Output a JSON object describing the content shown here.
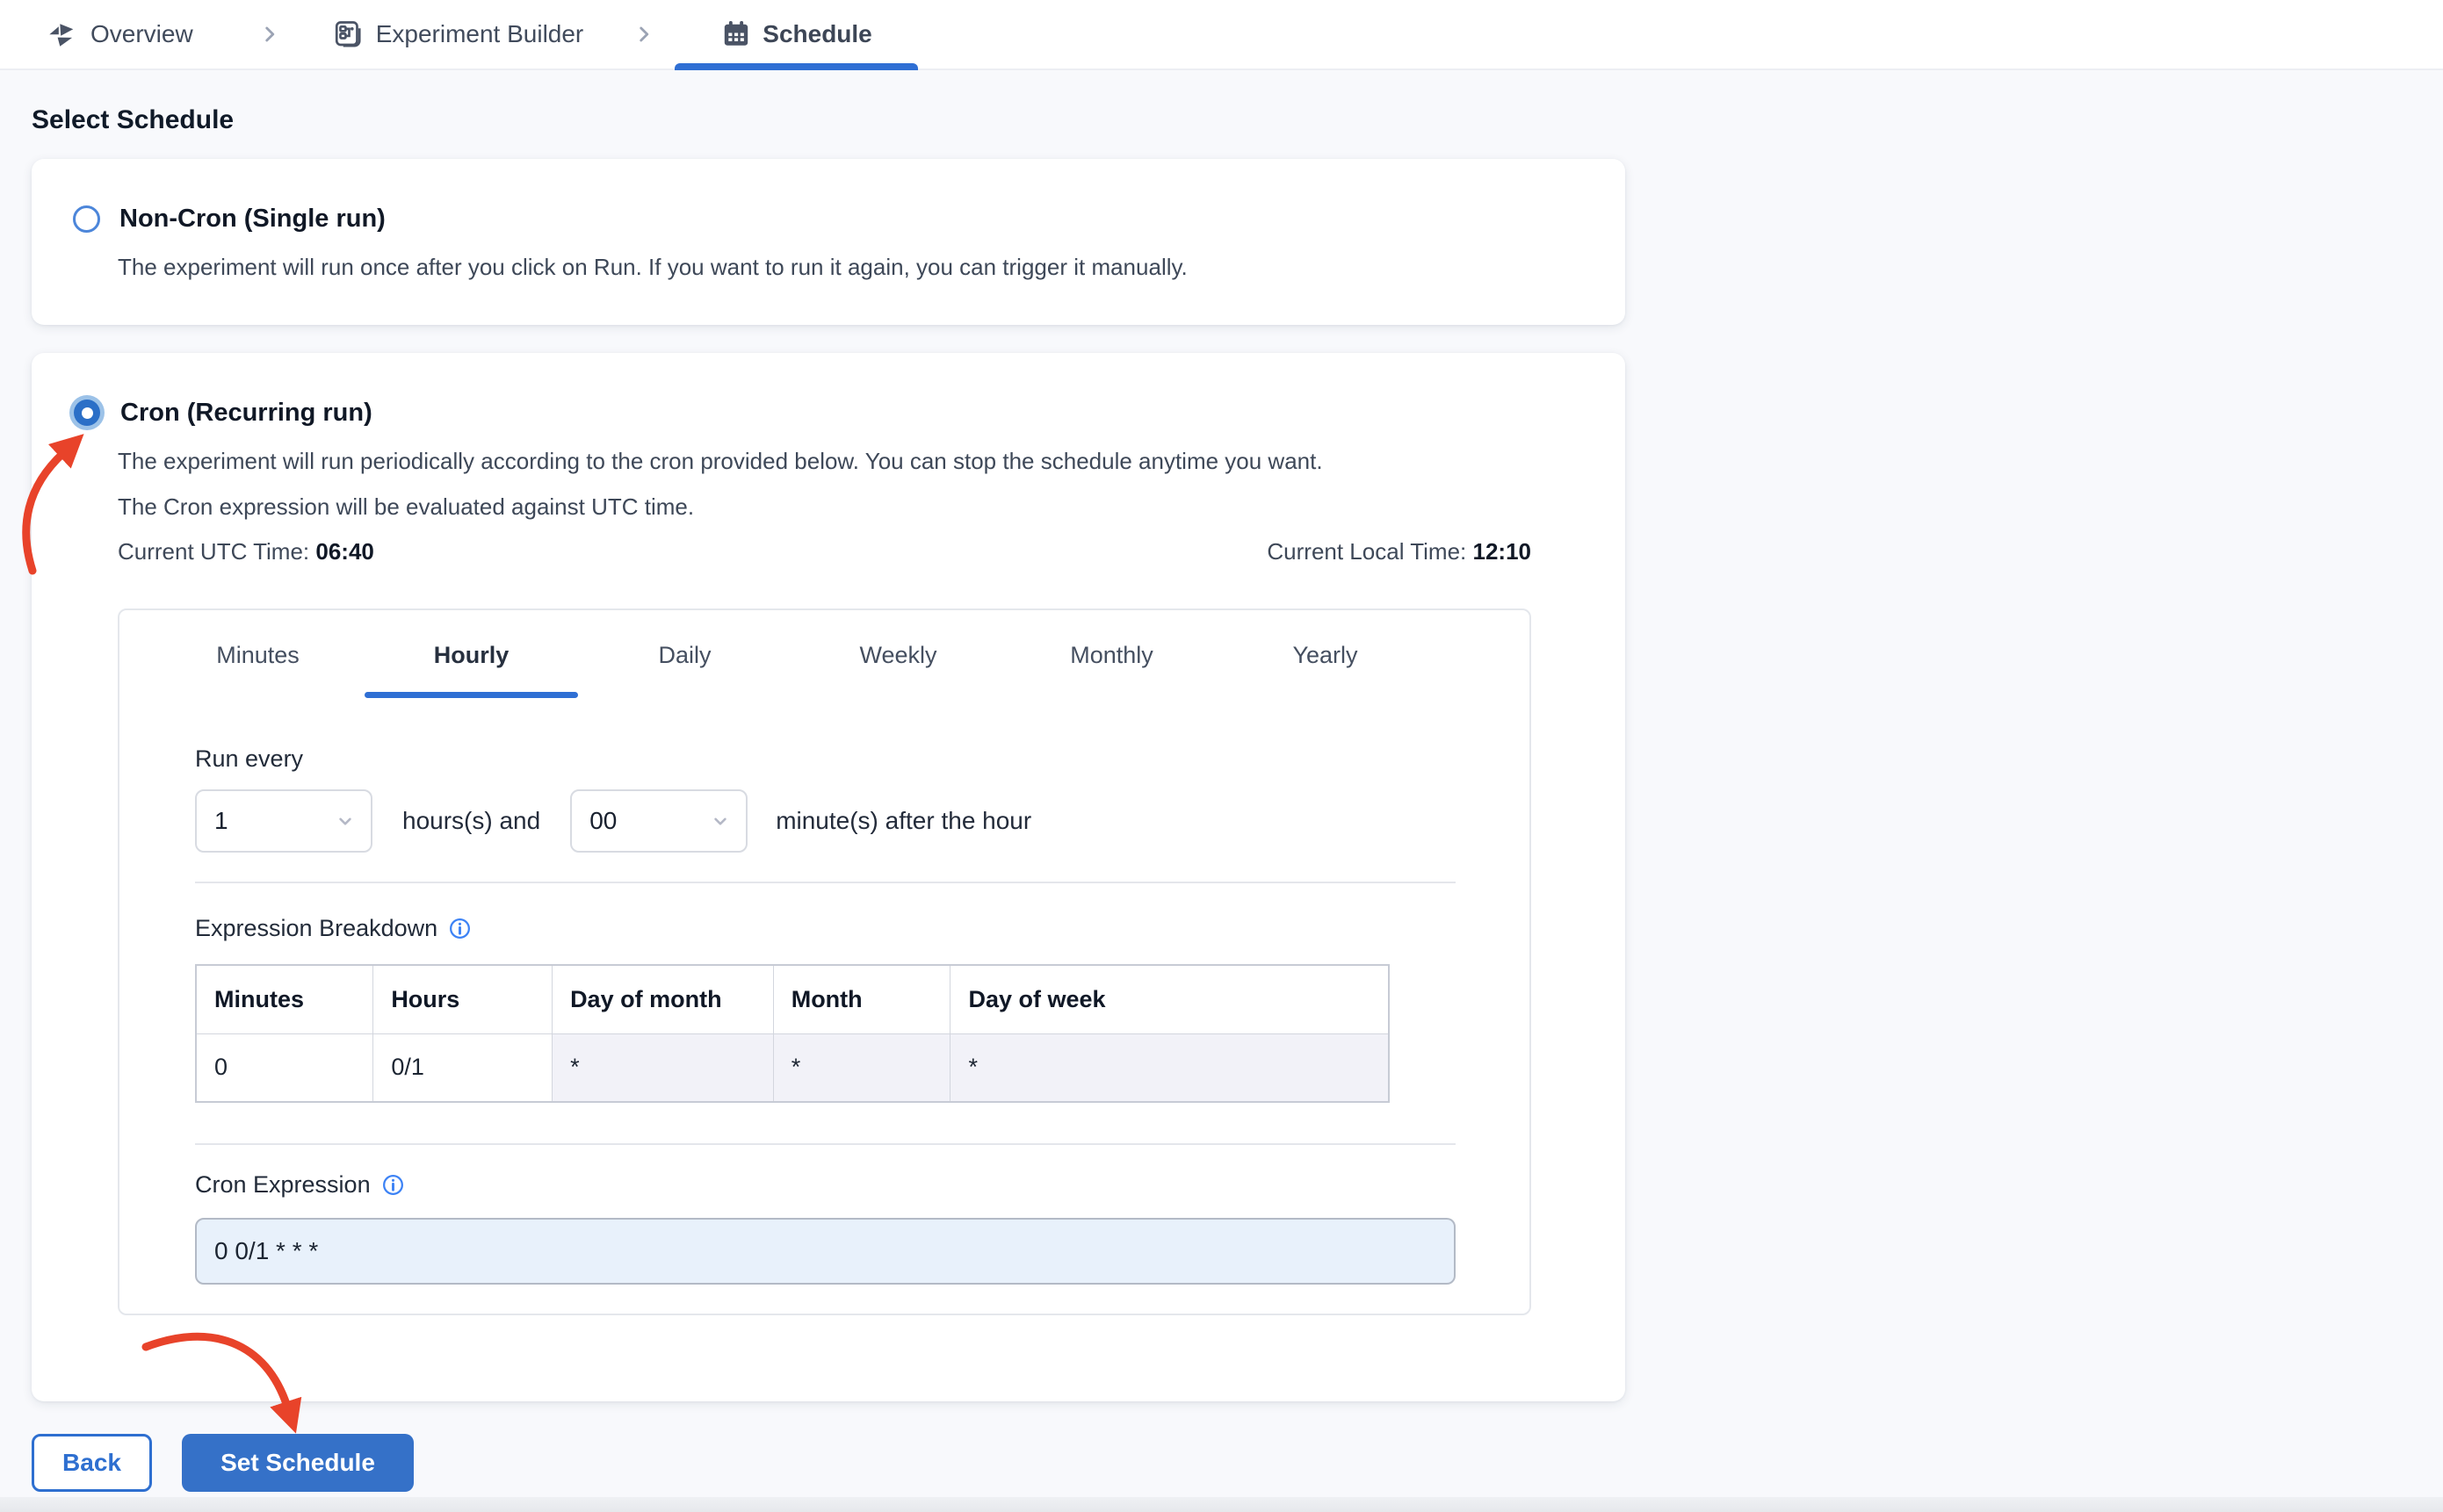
{
  "breadcrumb": {
    "items": [
      {
        "label": "Overview",
        "icon": "pinwheel-logo-icon"
      },
      {
        "label": "Experiment Builder",
        "icon": "experiment-builder-icon"
      },
      {
        "label": "Schedule",
        "icon": "calendar-icon",
        "active": true
      }
    ]
  },
  "page": {
    "heading": "Select Schedule"
  },
  "options": {
    "non_cron": {
      "selected": false,
      "title": "Non-Cron (Single run)",
      "description": "The experiment will run once after you click on Run. If you want to run it again, you can trigger it manually."
    },
    "cron": {
      "selected": true,
      "title": "Cron (Recurring run)",
      "description_line_1": "The experiment will run periodically according to the cron provided below. You can stop the schedule anytime you want.",
      "description_line_2": "The Cron expression will be evaluated against UTC time.",
      "current_utc_label": "Current UTC Time:",
      "current_utc_value": "06:40",
      "current_local_label": "Current Local Time:",
      "current_local_value": "12:10"
    }
  },
  "scheduler": {
    "tabs": [
      {
        "label": "Minutes"
      },
      {
        "label": "Hourly",
        "active": true
      },
      {
        "label": "Daily"
      },
      {
        "label": "Weekly"
      },
      {
        "label": "Monthly"
      },
      {
        "label": "Yearly"
      }
    ],
    "run_every_label": "Run every",
    "hours_select_value": "1",
    "hours_text": "hours(s) and",
    "minutes_select_value": "00",
    "minutes_text": "minute(s) after the hour",
    "expression_breakdown": {
      "label": "Expression Breakdown",
      "headers": [
        "Minutes",
        "Hours",
        "Day of month",
        "Month",
        "Day of week"
      ],
      "values": [
        "0",
        "0/1",
        "*",
        "*",
        "*"
      ]
    },
    "cron_expression": {
      "label": "Cron Expression",
      "value": "0 0/1 * * *"
    }
  },
  "footer": {
    "back_label": "Back",
    "submit_label": "Set Schedule"
  },
  "colors": {
    "accent_blue": "#2f6fd4",
    "button_blue": "#3571c8",
    "radio_blue": "#2b6fc7",
    "radio_halo": "#9cc2e8",
    "arrow_red": "#e8432a",
    "cron_input_bg": "#e8f1fb",
    "star_cell_bg": "#f2f2f8",
    "page_bg": "#f8f9fc"
  }
}
